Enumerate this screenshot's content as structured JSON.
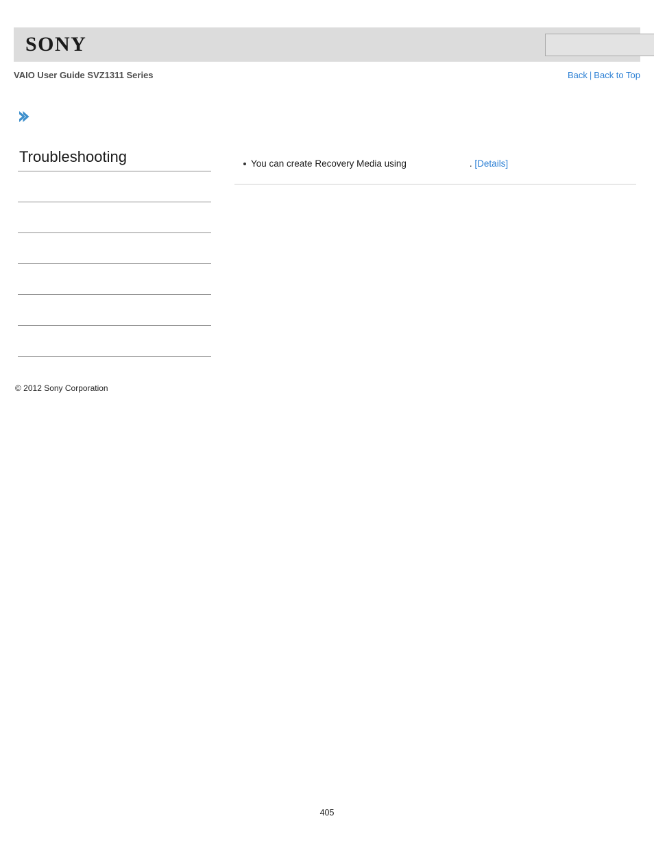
{
  "header": {
    "logo_text": "SONY",
    "search": {
      "value": "",
      "placeholder": "",
      "icon": "search-icon",
      "button_label": ""
    }
  },
  "sub_header": {
    "guide_title": "VAIO User Guide SVZ1311 Series",
    "nav": {
      "back_label": "Back",
      "separator": "|",
      "back_to_top_label": "Back to Top"
    }
  },
  "breadcrumb": {
    "icon": "chevron-right-icon",
    "text": ""
  },
  "sidebar": {
    "title": "Troubleshooting",
    "items": [
      {
        "label": ""
      },
      {
        "label": ""
      },
      {
        "label": ""
      },
      {
        "label": ""
      },
      {
        "label": ""
      },
      {
        "label": ""
      }
    ]
  },
  "main": {
    "bullets": [
      {
        "text_before": "You can create Recovery Media using",
        "blank": "",
        "text_after": ".",
        "link_label": "[Details]"
      }
    ]
  },
  "footer": {
    "copyright": "© 2012 Sony Corporation",
    "page_number": "405"
  },
  "colors": {
    "header_background": "#dcdcdc",
    "link_blue": "#2b7fd4",
    "rule_gray": "#8c8c8c",
    "content_rule_gray": "#cfcfcf",
    "chevron_blue": "#3d8fcc"
  }
}
